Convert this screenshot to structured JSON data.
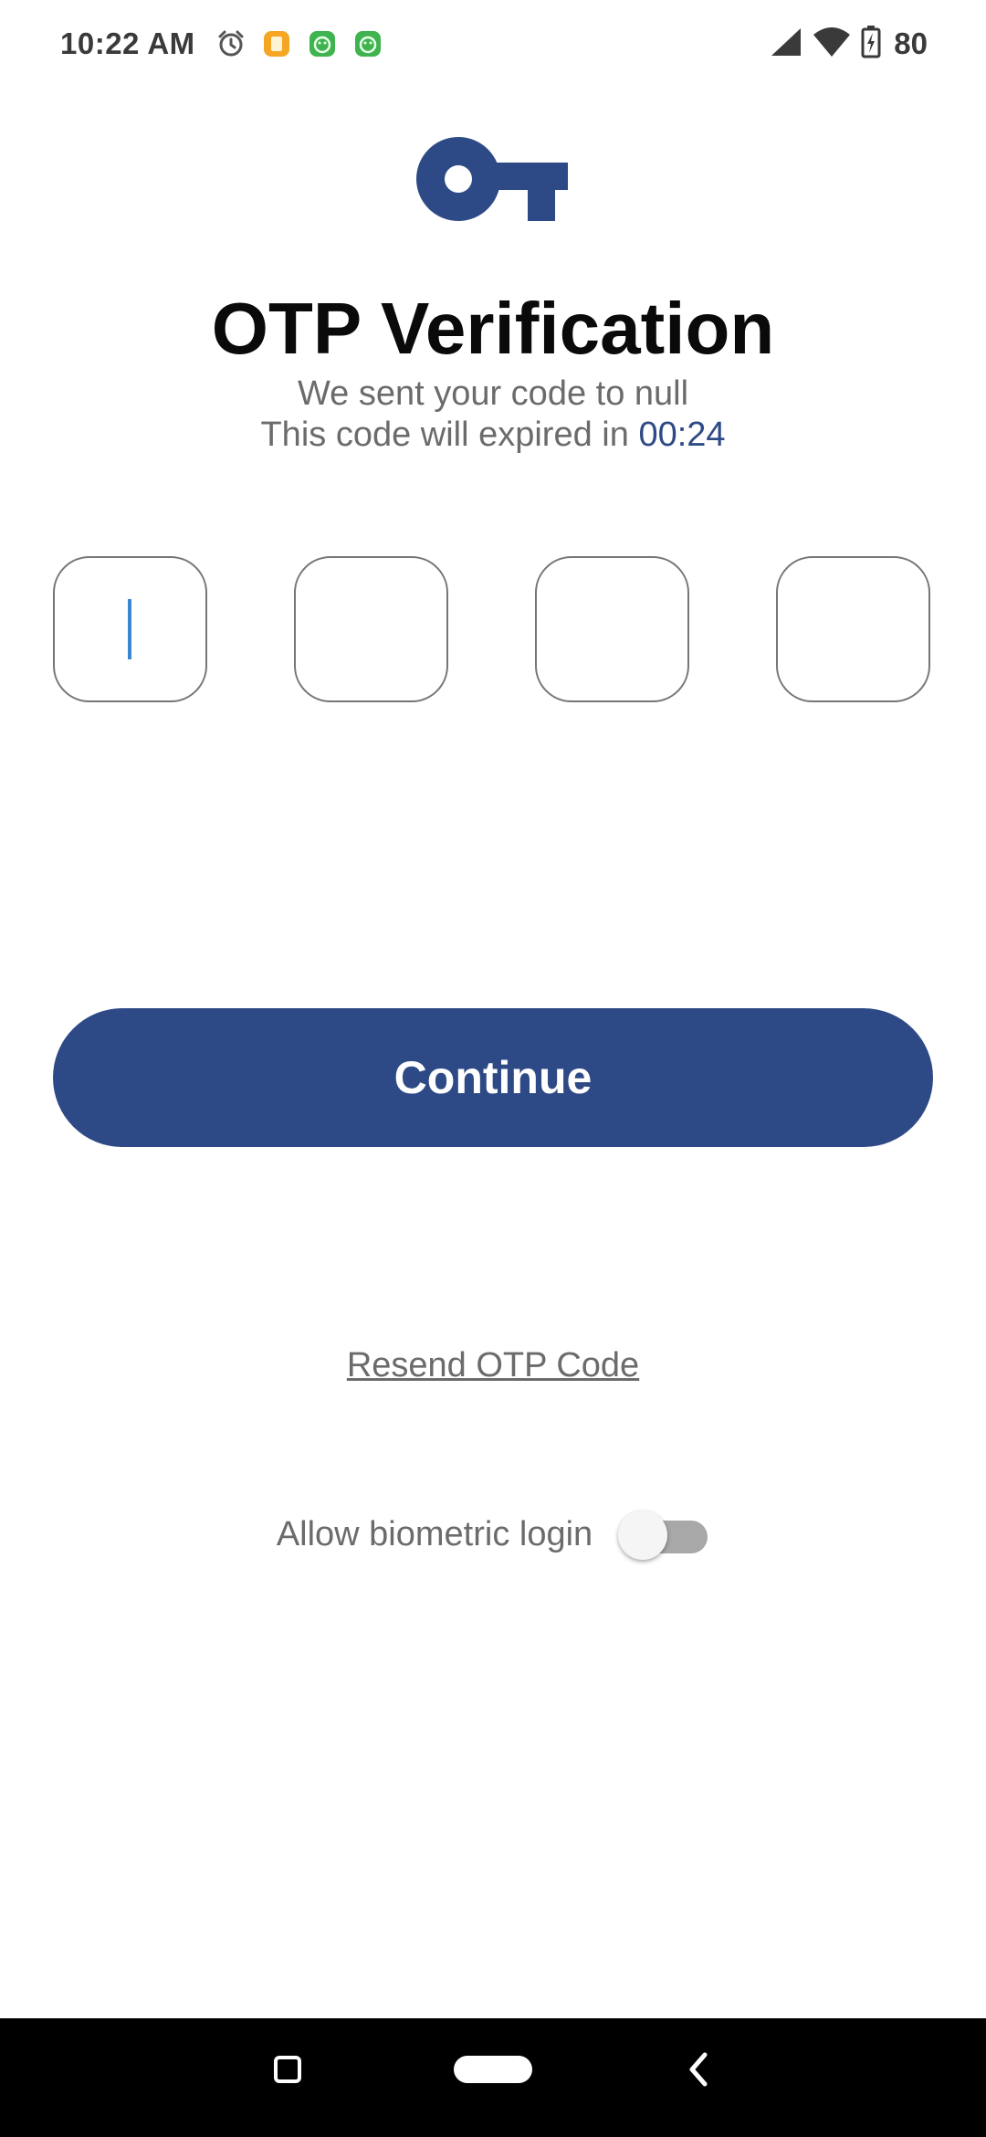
{
  "status_bar": {
    "time": "10:22 AM",
    "battery": "80",
    "icons": [
      "alarm-icon",
      "notification-app-icon",
      "notification-app-icon",
      "notification-app-icon",
      "signal-icon",
      "wifi-icon",
      "battery-charging-icon"
    ]
  },
  "header": {
    "icon": "key-icon",
    "title": "OTP Verification",
    "subtitle_line1": "We sent your code to null",
    "subtitle_line2_prefix": "This code will expired in ",
    "countdown": "00:24"
  },
  "otp": {
    "digits": [
      "",
      "",
      "",
      ""
    ],
    "active_index": 0
  },
  "continue_button": {
    "label": "Continue"
  },
  "resend_link": {
    "label": "Resend OTP Code"
  },
  "biometric": {
    "label": "Allow biometric login",
    "enabled": false
  },
  "colors": {
    "primary": "#2e4a86",
    "text_muted": "#6b6b6b",
    "cursor": "#3a86d1"
  },
  "nav_bar": {
    "icons": [
      "recents-icon",
      "home-icon",
      "back-icon"
    ]
  }
}
